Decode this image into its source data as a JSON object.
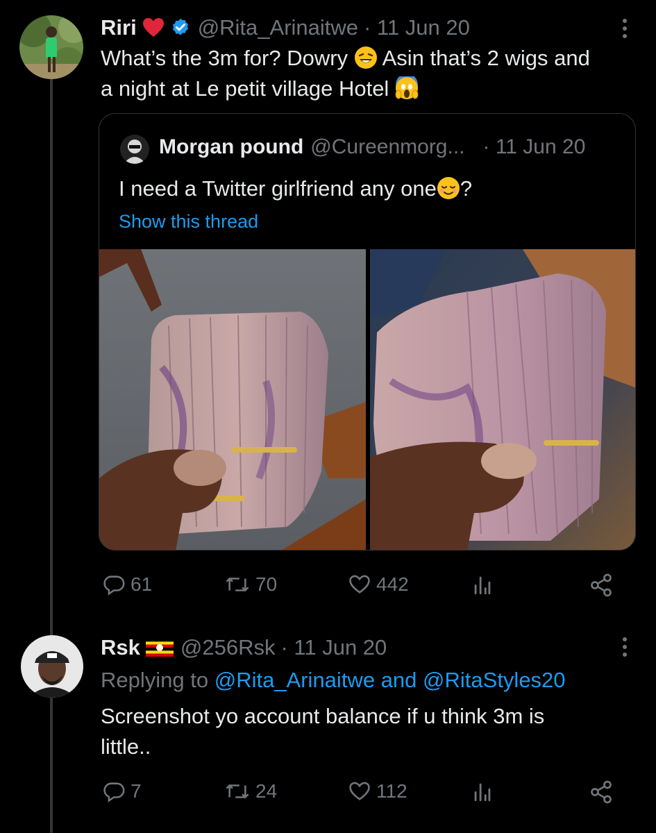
{
  "tweet1": {
    "display_name": "Riri",
    "heart": "❤️",
    "handle": "@Rita_Arinaitwe",
    "date": "· 11 Jun 20",
    "text_line1_a": "What’s the 3m for? Dowry",
    "text_line1_b": "Asin that’s 2 wigs and",
    "text_line2": "a night at Le petit village Hotel",
    "quote": {
      "display_name": "Morgan pound",
      "handle": "@Cureenmorg...",
      "date": "· 11 Jun 20",
      "text": "I need a Twitter girlfriend any one",
      "text_end": "?",
      "show_thread": "Show this thread"
    },
    "stats": {
      "replies": "61",
      "retweets": "70",
      "likes": "442"
    }
  },
  "tweet2": {
    "display_name": "Rsk",
    "handle": "@256Rsk",
    "date": "· 11 Jun 20",
    "replying_prefix": "Replying to",
    "replying_user1": "@Rita_Arinaitwe",
    "replying_and": "and",
    "replying_user2": "@RitaStyles20",
    "text_line1": "Screenshot yo account balance if u think 3m is",
    "text_line2": "little..",
    "stats": {
      "replies": "7",
      "retweets": "24",
      "likes": "112"
    }
  },
  "icons": {
    "verified": "verified-badge-icon",
    "more": "more-options-icon",
    "reply": "reply-icon",
    "retweet": "retweet-icon",
    "like": "like-icon",
    "views": "views-icon",
    "share": "share-icon"
  },
  "colors": {
    "background": "#000000",
    "text": "#e7e9ea",
    "muted": "#71767b",
    "link": "#1d9bf0",
    "verified": "#1d9bf0",
    "heart": "#f91880"
  }
}
